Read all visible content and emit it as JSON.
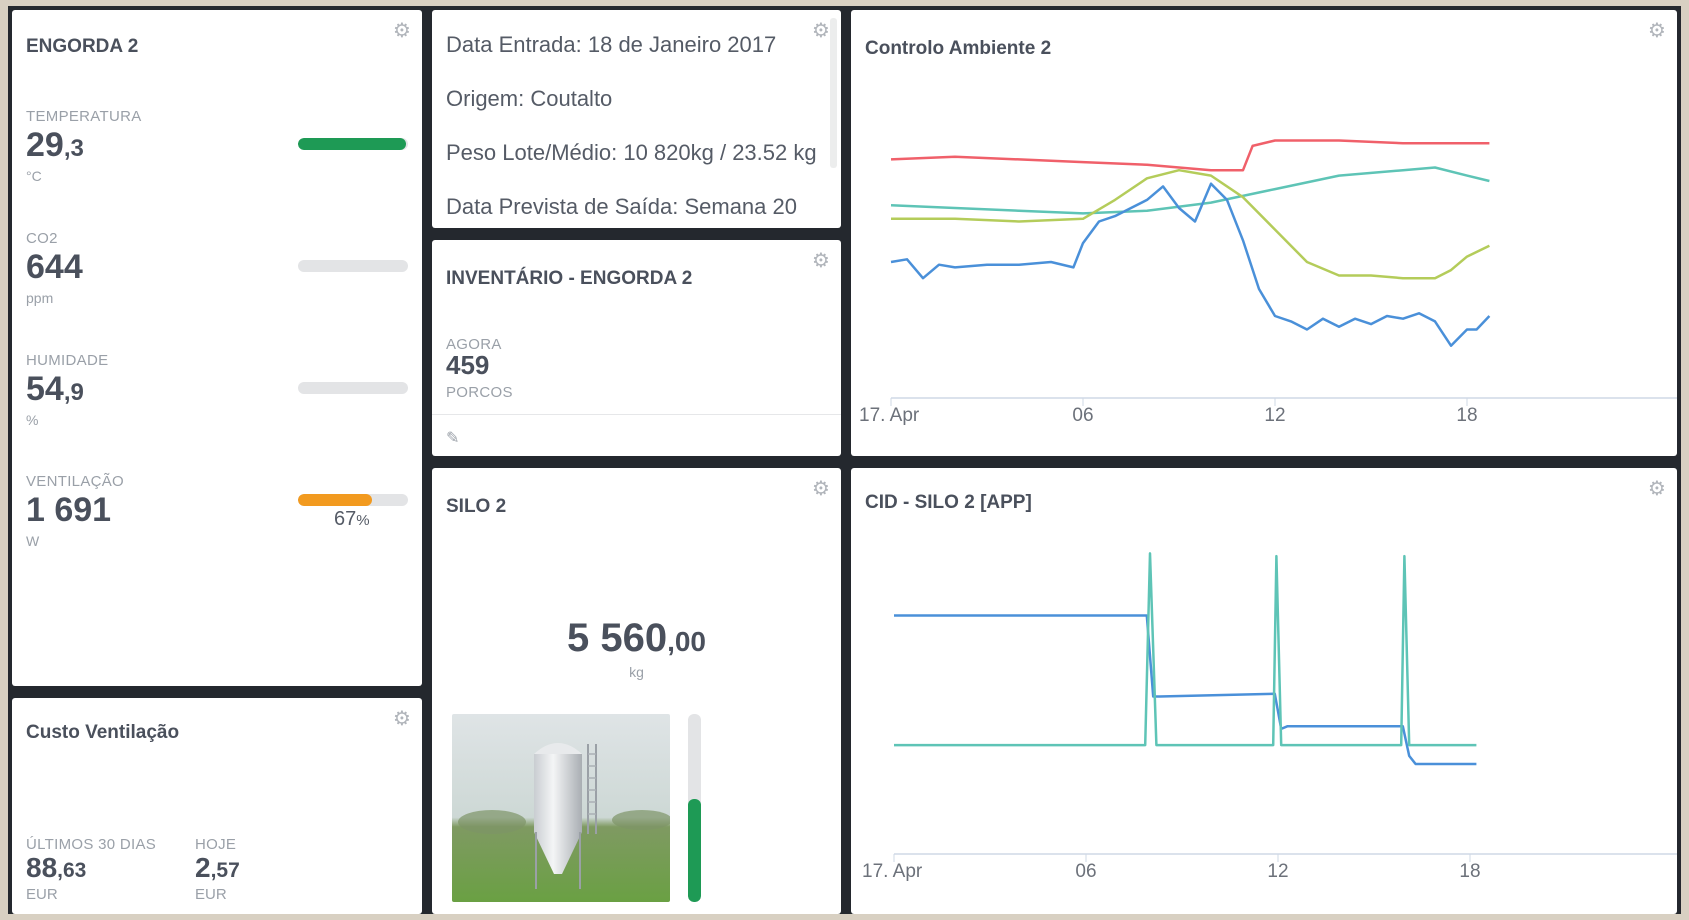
{
  "engorda": {
    "title": "ENGORDA 2",
    "metrics": [
      {
        "label": "TEMPERATURA",
        "int": "29",
        "dec": ",3",
        "unit": "°C",
        "level": 0.98,
        "color": "#1e9a55"
      },
      {
        "label": "CO2",
        "int": "644",
        "dec": "",
        "unit": "ppm",
        "level": 0,
        "color": "#1e9a55"
      },
      {
        "label": "HUMIDADE",
        "int": "54",
        "dec": ",9",
        "unit": "%",
        "level": 0,
        "color": "#1e9a55"
      },
      {
        "label": "VENTILAÇÃO",
        "int": "1 691",
        "dec": "",
        "unit": "W",
        "level": 0.67,
        "color": "#f29a1f",
        "pct_int": "67",
        "pct_unit": "%"
      }
    ]
  },
  "custo": {
    "title": "Custo Ventilação",
    "left_label": "ÚLTIMOS 30 DIAS",
    "left_int": "88",
    "left_dec": ",63",
    "left_unit": "EUR",
    "right_label": "HOJE",
    "right_int": "2",
    "right_dec": ",57",
    "right_unit": "EUR"
  },
  "info": {
    "lines": [
      "Data Entrada: 18 de Janeiro 2017",
      "Origem: Coutalto",
      "Peso Lote/Médio: 10 820kg / 23.52 kg",
      "Data Prevista de Saída: Semana 20"
    ]
  },
  "inventario": {
    "title": "INVENTÁRIO - ENGORDA 2",
    "label": "AGORA",
    "value": "459",
    "unit": "PORCOS"
  },
  "silo": {
    "title": "SILO 2",
    "int": "5 560",
    "dec": ",00",
    "unit": "kg",
    "level": 0.55,
    "level_color": "#1e9a55"
  },
  "chart_data": [
    {
      "type": "line",
      "title": "Controlo Ambiente 2",
      "x_ticks": [
        "17. Apr",
        "06",
        "12",
        "18"
      ],
      "x_tick_hours": [
        0,
        6,
        12,
        18
      ],
      "xlim": [
        0,
        24
      ],
      "ylim": [
        0,
        100
      ],
      "grid": false,
      "series": [
        {
          "color": "#f0606a",
          "x": [
            0,
            2,
            4,
            6,
            8,
            10,
            11,
            11.3,
            12,
            14,
            16,
            18,
            18.7
          ],
          "y": [
            78,
            79,
            78,
            77,
            76,
            74,
            74,
            83,
            85,
            85,
            84,
            84,
            84
          ]
        },
        {
          "color": "#5ec4b6",
          "x": [
            0,
            2,
            4,
            6,
            8,
            10,
            12,
            14,
            16,
            17,
            18,
            18.7
          ],
          "y": [
            61,
            60,
            59,
            58,
            59,
            62,
            67,
            72,
            74,
            75,
            72,
            70
          ]
        },
        {
          "color": "#b4cc5a",
          "x": [
            0,
            2,
            4,
            6,
            7,
            8,
            9,
            10,
            11,
            12,
            13,
            14,
            15,
            16,
            17,
            17.5,
            18,
            18.7
          ],
          "y": [
            56,
            56,
            55,
            56,
            63,
            71,
            74,
            72,
            64,
            52,
            40,
            35,
            35,
            34,
            34,
            37,
            42,
            46
          ]
        },
        {
          "color": "#4a90d9",
          "x": [
            0,
            0.5,
            1,
            1.5,
            2,
            3,
            4,
            5,
            5.7,
            6,
            6.5,
            7,
            7.5,
            8,
            8.5,
            9,
            9.5,
            10,
            10.5,
            11,
            11.5,
            12,
            12.5,
            13,
            13.5,
            14,
            14.5,
            15,
            15.5,
            16,
            16.5,
            17,
            17.5,
            18,
            18.3,
            18.7
          ],
          "y": [
            40,
            41,
            34,
            39,
            38,
            39,
            39,
            40,
            38,
            47,
            55,
            57,
            60,
            63,
            68,
            60,
            55,
            69,
            63,
            48,
            30,
            20,
            18,
            15,
            19,
            16,
            19,
            17,
            20,
            19,
            21,
            18,
            9,
            15,
            15,
            20
          ]
        }
      ]
    },
    {
      "type": "line",
      "title": "CID - SILO 2 [APP]",
      "x_ticks": [
        "17. Apr",
        "06",
        "12",
        "18"
      ],
      "x_tick_hours": [
        0,
        6,
        12,
        18
      ],
      "xlim": [
        0,
        24
      ],
      "ylim": [
        0,
        100
      ],
      "grid": false,
      "series": [
        {
          "color": "#4a90d9",
          "x": [
            0,
            7.9,
            8.1,
            8.3,
            11.9,
            12.1,
            12.3,
            15.9,
            16.1,
            16.3,
            18.2
          ],
          "y": [
            75,
            75,
            45,
            45,
            46,
            33,
            34,
            34,
            23,
            20,
            20
          ]
        },
        {
          "color": "#5ec4b6",
          "x": [
            0,
            7.85,
            8.0,
            8.2,
            11.85,
            11.95,
            12.1,
            15.85,
            15.95,
            16.1,
            18.2
          ],
          "y": [
            27,
            27,
            98,
            27,
            27,
            97,
            27,
            27,
            97,
            27,
            27
          ]
        }
      ]
    }
  ]
}
